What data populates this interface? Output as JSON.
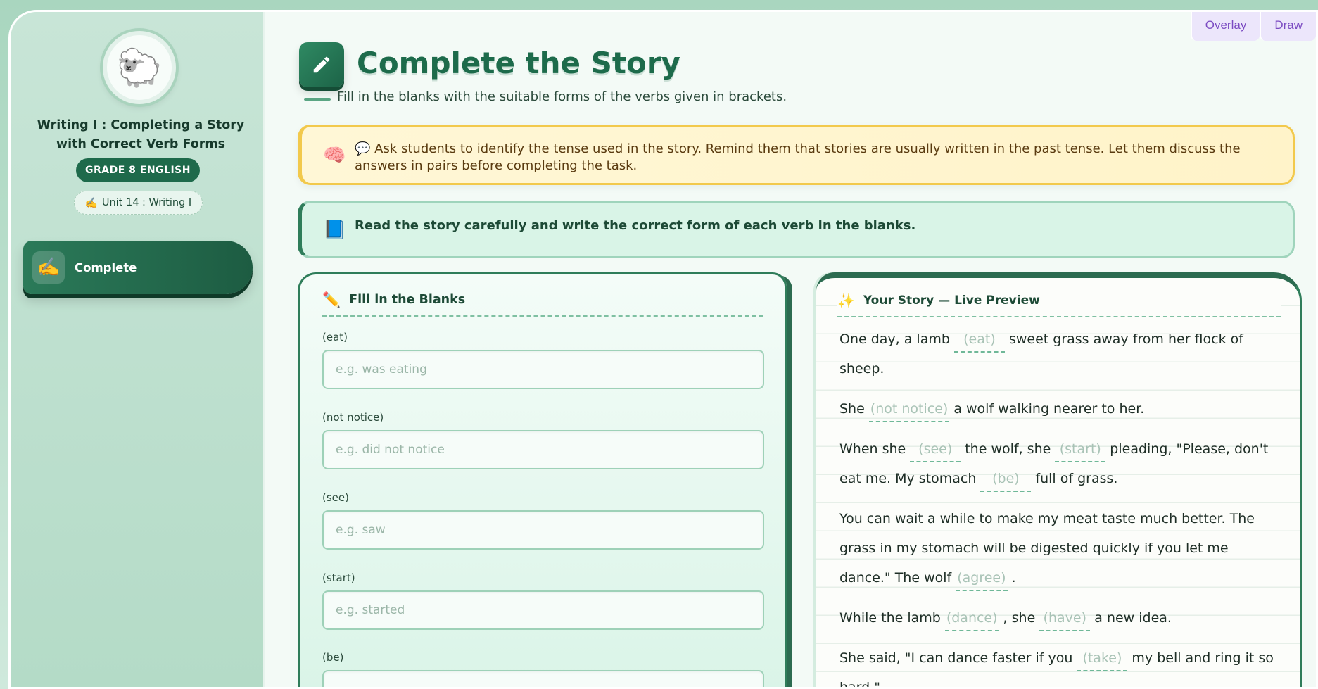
{
  "top_buttons": {
    "overlay": "Overlay",
    "draw": "Draw"
  },
  "sidebar": {
    "avatar_emoji": "🐑",
    "title_line1": "Writing I : Completing a Story",
    "title_line2": "with Correct Verb Forms",
    "grade_badge": "GRADE 8 ENGLISH",
    "unit_chip": "Unit 14 : Writing I",
    "unit_icon": "✍️",
    "nav_items": [
      {
        "label": "Complete",
        "icon": "✍️"
      }
    ]
  },
  "header": {
    "title": "Complete the Story",
    "subtitle": "Fill in the blanks with the suitable forms of the verbs given in brackets."
  },
  "teacher_note": {
    "icon": "🧠",
    "speech_icon": "💬",
    "text": "Ask students to identify the tense used in the story. Remind them that stories are usually written in the past tense. Let them discuss the answers in pairs before completing the task."
  },
  "instruction": {
    "icon": "📘",
    "text": "Read the story carefully and write the correct form of each verb in the blanks."
  },
  "blanks_card": {
    "icon": "✏️",
    "title": "Fill in the Blanks",
    "fields": [
      {
        "label": "(eat)",
        "placeholder": "e.g. was eating",
        "value": ""
      },
      {
        "label": "(not notice)",
        "placeholder": "e.g. did not notice",
        "value": ""
      },
      {
        "label": "(see)",
        "placeholder": "e.g. saw",
        "value": ""
      },
      {
        "label": "(start)",
        "placeholder": "e.g. started",
        "value": ""
      },
      {
        "label": "(be)",
        "placeholder": "",
        "value": ""
      }
    ]
  },
  "preview_card": {
    "icon": "✨",
    "title": "Your Story — Live Preview",
    "p1": {
      "t1": "One day, a lamb",
      "b1": "(eat)",
      "t2": "sweet grass away from her flock of sheep."
    },
    "p2": {
      "t1": "She",
      "b1": "(not notice)",
      "t2": "a wolf walking nearer to her."
    },
    "p3": {
      "t1": "When she",
      "b1": "(see)",
      "t2": "the wolf, she",
      "b2": "(start)",
      "t3": "pleading, \"Please, don't eat me. My stomach",
      "b3": "(be)",
      "t4": "full of grass."
    },
    "p4": {
      "t1": "You can wait a while to make my meat taste much better. The grass in my stomach will be digested quickly if you let me dance.\" The wolf",
      "b1": "(agree)",
      "t2": "."
    },
    "p5": {
      "t1": "While the lamb",
      "b1": "(dance)",
      "t2": ", she",
      "b2": "(have)",
      "t3": "a new idea."
    },
    "p6": {
      "t1": "She said, \"I can dance faster if you",
      "b1": "(take)",
      "t2": "my bell and ring it so hard.\""
    }
  }
}
